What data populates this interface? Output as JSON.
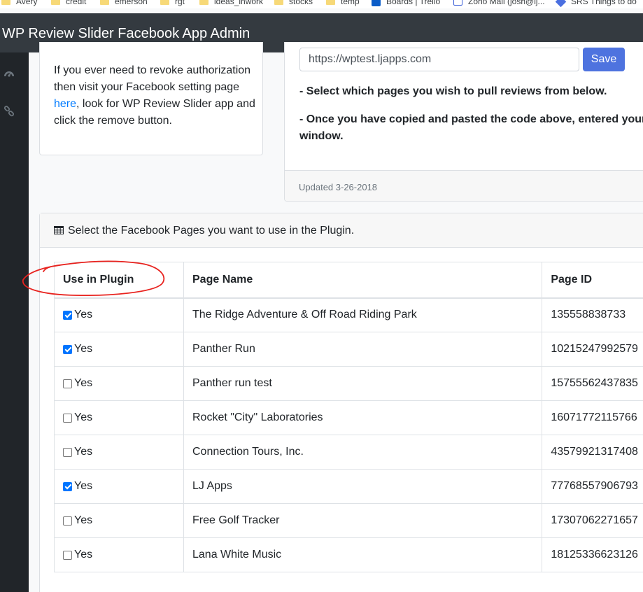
{
  "bookmarks": [
    {
      "label": "Avery",
      "icon": "folder-icon"
    },
    {
      "label": "credit",
      "icon": "folder-icon"
    },
    {
      "label": "emerson",
      "icon": "folder-icon"
    },
    {
      "label": "rgt",
      "icon": "folder-icon"
    },
    {
      "label": "ideas_inwork",
      "icon": "folder-icon"
    },
    {
      "label": "stocks",
      "icon": "folder-icon"
    },
    {
      "label": "temp",
      "icon": "folder-icon"
    },
    {
      "label": "Boards | Trello",
      "icon": "trello-icon"
    },
    {
      "label": "Zoho Mail (josh@lj...",
      "icon": "mail-icon"
    },
    {
      "label": "SRS Things to do",
      "icon": "diamond-icon"
    }
  ],
  "navbar": {
    "title": "WP Review Slider Facebook App Admin"
  },
  "sidebar": {
    "icons": [
      "dashboard-icon",
      "link-icon"
    ]
  },
  "left_card": {
    "text_before": "If you ever need to revoke authorization then visit your Facebook setting page ",
    "link": "here",
    "text_after": ", look for WP Review Slider app and click the remove button."
  },
  "right_card": {
    "url_value": "https://wptest.ljapps.com",
    "save_label": "Save",
    "instruction_1": "- Select which pages you wish to pull reviews from below.",
    "instruction_2a": "- Once you have copied and pasted the code above, entered your",
    "instruction_2b": "window.",
    "footer": "Updated 3-26-2018"
  },
  "table_card": {
    "header_icon": "table-icon",
    "title": "Select the Facebook Pages you want to use in the Plugin.",
    "columns": [
      "Use in Plugin",
      "Page Name",
      "Page ID"
    ],
    "rows": [
      {
        "checked": true,
        "label": "Yes",
        "name": "The Ridge Adventure & Off Road Riding Park",
        "id": "135558838733"
      },
      {
        "checked": true,
        "label": "Yes",
        "name": "Panther Run",
        "id": "10215247992579"
      },
      {
        "checked": false,
        "label": "Yes",
        "name": "Panther run test",
        "id": "15755562437835"
      },
      {
        "checked": false,
        "label": "Yes",
        "name": "Rocket \"City\" Laboratories",
        "id": "16071772115766"
      },
      {
        "checked": false,
        "label": "Yes",
        "name": "Connection Tours, Inc.",
        "id": "43579921317408"
      },
      {
        "checked": true,
        "label": "Yes",
        "name": "LJ Apps",
        "id": "77768557906793"
      },
      {
        "checked": false,
        "label": "Yes",
        "name": "Free Golf Tracker",
        "id": "17307062271657"
      },
      {
        "checked": false,
        "label": "Yes",
        "name": "Lana White Music",
        "id": "18125336623126"
      }
    ]
  },
  "colors": {
    "navbar": "#343a40",
    "sidebar": "#212529",
    "accent": "#4e73df",
    "checkbox": "#0075ff",
    "annotation": "#e8231f"
  }
}
